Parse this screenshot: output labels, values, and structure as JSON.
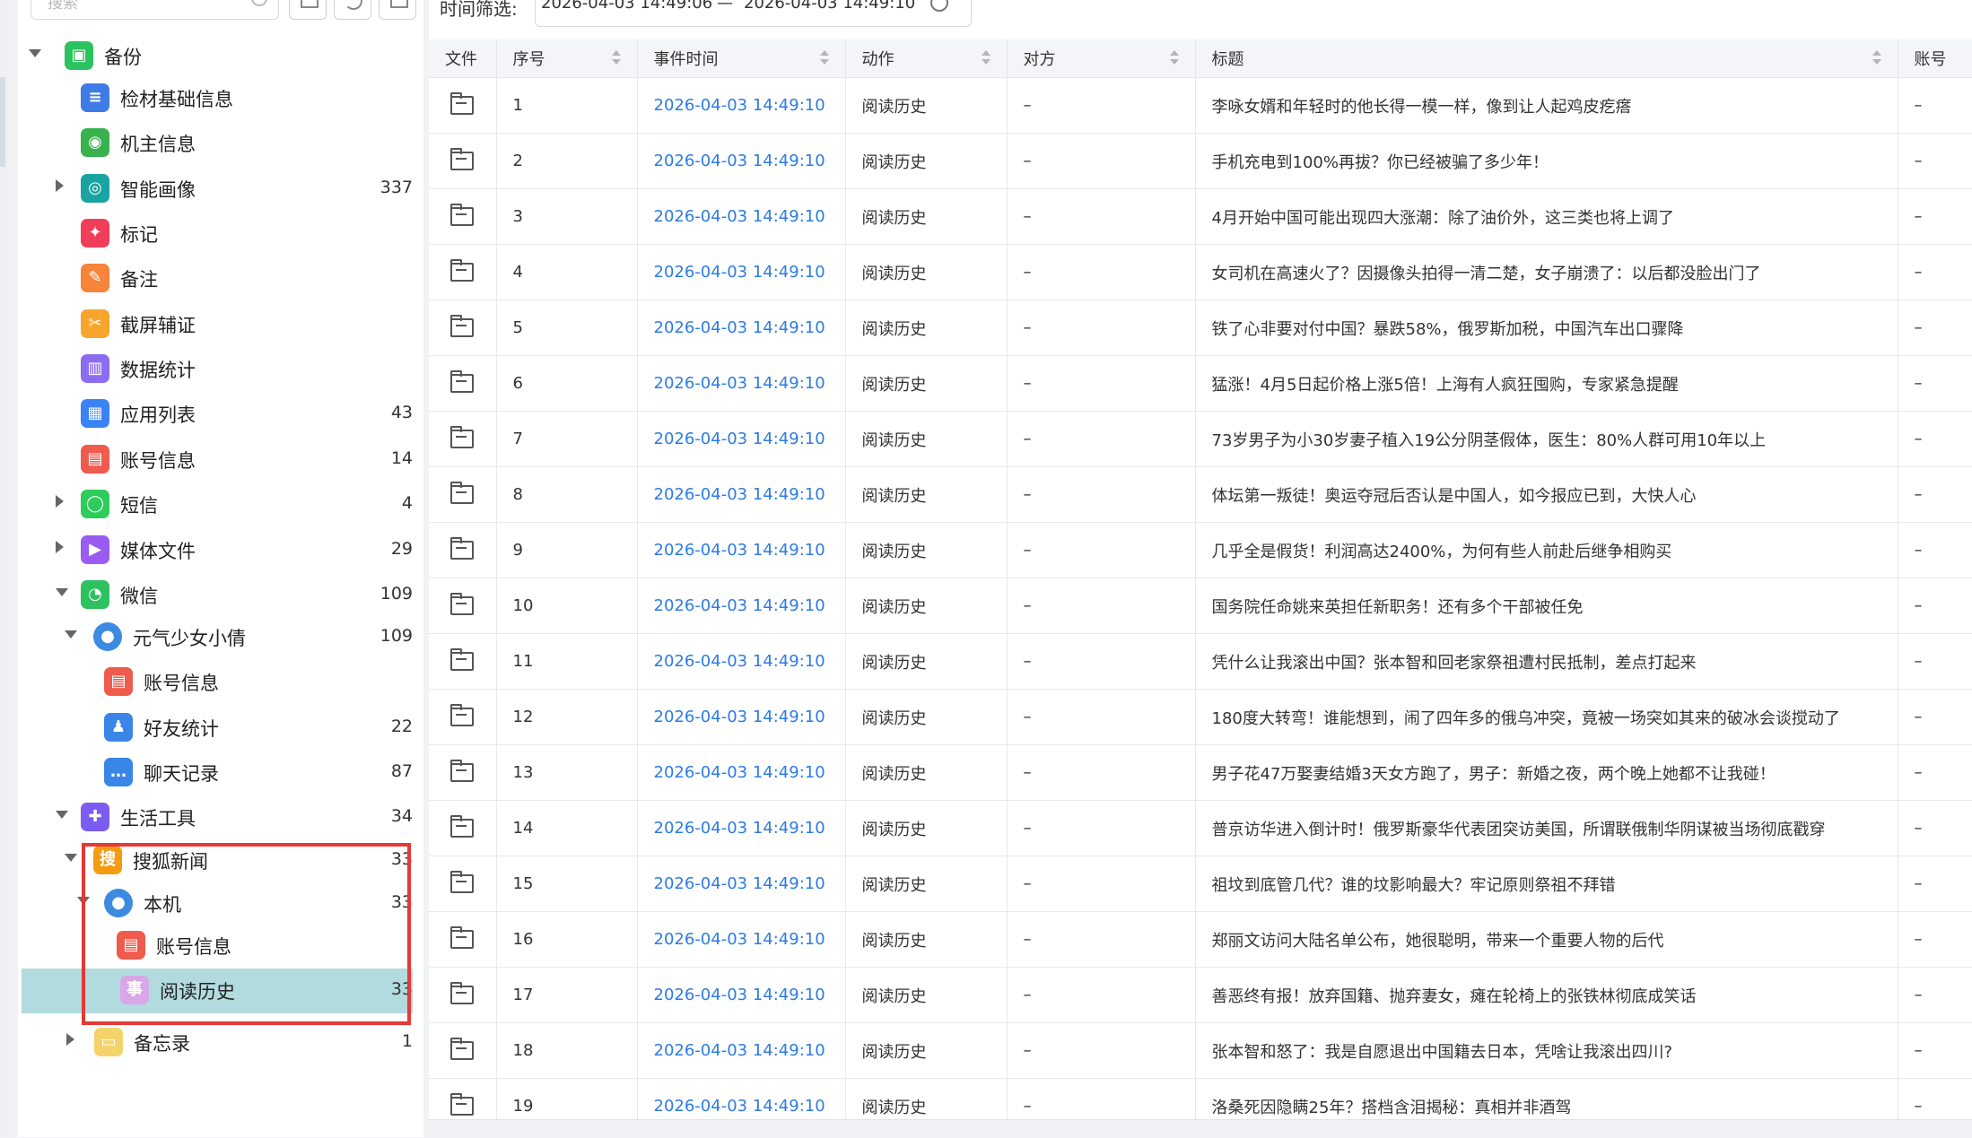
{
  "sidebar": {
    "search_placeholder": "搜索",
    "tree": [
      {
        "label": "备份",
        "count": "",
        "depth": 0,
        "arrow": "down",
        "icon": "backup-icon",
        "color": "#2bc35e",
        "glyph": "▣"
      },
      {
        "label": "检材基础信息",
        "count": "",
        "depth": 1,
        "arrow": "",
        "icon": "document-icon",
        "color": "#3f7be6",
        "glyph": "≡"
      },
      {
        "label": "机主信息",
        "count": "",
        "depth": 1,
        "arrow": "",
        "icon": "owner-icon",
        "color": "#37b24d",
        "glyph": "◉"
      },
      {
        "label": "智能画像",
        "count": "337",
        "depth": 1,
        "arrow": "right",
        "icon": "portrait-icon",
        "color": "#1aa3a3",
        "glyph": "◎"
      },
      {
        "label": "标记",
        "count": "",
        "depth": 1,
        "arrow": "",
        "icon": "pin-icon",
        "color": "#f03e5a",
        "glyph": "✦"
      },
      {
        "label": "备注",
        "count": "",
        "depth": 1,
        "arrow": "",
        "icon": "note-icon",
        "color": "#f6843b",
        "glyph": "✎"
      },
      {
        "label": "截屏辅证",
        "count": "",
        "depth": 1,
        "arrow": "",
        "icon": "scissors-icon",
        "color": "#f7a52c",
        "glyph": "✂"
      },
      {
        "label": "数据统计",
        "count": "",
        "depth": 1,
        "arrow": "",
        "icon": "bar-chart-icon",
        "color": "#8c6cf0",
        "glyph": "▥"
      },
      {
        "label": "应用列表",
        "count": "43",
        "depth": 1,
        "arrow": "",
        "icon": "apps-grid-icon",
        "color": "#3b82f6",
        "glyph": "▦"
      },
      {
        "label": "账号信息",
        "count": "14",
        "depth": 1,
        "arrow": "",
        "icon": "id-card-icon",
        "color": "#ef5b4c",
        "glyph": "▤"
      },
      {
        "label": "短信",
        "count": "4",
        "depth": 1,
        "arrow": "right",
        "icon": "sms-icon",
        "color": "#2ecc5a",
        "glyph": "◯"
      },
      {
        "label": "媒体文件",
        "count": "29",
        "depth": 1,
        "arrow": "right",
        "icon": "media-icon",
        "color": "#9a5cf0",
        "glyph": "▶"
      },
      {
        "label": "微信",
        "count": "109",
        "depth": 1,
        "arrow": "down",
        "icon": "wechat-icon",
        "color": "#2ec15f",
        "glyph": "◔"
      },
      {
        "label": "元气少女小倩",
        "count": "109",
        "depth": 2,
        "arrow": "down",
        "icon": "user-avatar-icon",
        "color": "#3d8be0",
        "glyph": "●"
      },
      {
        "label": "账号信息",
        "count": "",
        "depth": 3,
        "arrow": "",
        "icon": "id-card-icon",
        "color": "#ef5b4c",
        "glyph": "▤"
      },
      {
        "label": "好友统计",
        "count": "22",
        "depth": 3,
        "arrow": "",
        "icon": "friends-icon",
        "color": "#3a86e8",
        "glyph": "♟"
      },
      {
        "label": "聊天记录",
        "count": "87",
        "depth": 3,
        "arrow": "",
        "icon": "chat-icon",
        "color": "#3a86e8",
        "glyph": "…"
      },
      {
        "label": "生活工具",
        "count": "34",
        "depth": 1,
        "arrow": "down",
        "icon": "tools-icon",
        "color": "#7b5cf0",
        "glyph": "✚"
      },
      {
        "label": "搜狐新闻",
        "count": "33",
        "depth": 2,
        "arrow": "down",
        "icon": "sohu-news-icon",
        "color": "#f39c12",
        "glyph": "搜"
      },
      {
        "label": "本机",
        "count": "33",
        "depth": 2.5,
        "arrow": "down",
        "icon": "user-avatar-icon",
        "color": "#3d8be0",
        "glyph": "●"
      },
      {
        "label": "账号信息",
        "count": "",
        "depth": 3.5,
        "arrow": "",
        "icon": "id-card-icon",
        "color": "#ef5b4c",
        "glyph": "▤"
      },
      {
        "label": "阅读历史",
        "count": "33",
        "depth": 3.5,
        "arrow": "",
        "icon": "reading-history-icon",
        "color": "#d9a6e8",
        "glyph": "事",
        "selected": true
      },
      {
        "label": "备忘录",
        "count": "1",
        "depth": 1.5,
        "arrow": "right",
        "icon": "memo-icon",
        "color": "#f5d36b",
        "glyph": "▭"
      }
    ]
  },
  "filter": {
    "label": "时间筛选:",
    "start": "2026-04-03 14:49:06",
    "sep": "—",
    "end": "2026-04-03 14:49:10"
  },
  "table": {
    "columns": [
      "文件",
      "序号",
      "事件时间",
      "动作",
      "对方",
      "标题",
      "账号"
    ],
    "rows": [
      {
        "seq": "1",
        "time": "2026-04-03 14:49:10",
        "action": "阅读历史",
        "party": "–",
        "title": "李咏女婿和年轻时的他长得一模一样，像到让人起鸡皮疙瘩",
        "account": "–"
      },
      {
        "seq": "2",
        "time": "2026-04-03 14:49:10",
        "action": "阅读历史",
        "party": "–",
        "title": "手机充电到100%再拔？你已经被骗了多少年！",
        "account": "–"
      },
      {
        "seq": "3",
        "time": "2026-04-03 14:49:10",
        "action": "阅读历史",
        "party": "–",
        "title": "4月开始中国可能出现四大涨潮：除了油价外，这三类也将上调了",
        "account": "–"
      },
      {
        "seq": "4",
        "time": "2026-04-03 14:49:10",
        "action": "阅读历史",
        "party": "–",
        "title": "女司机在高速火了？因摄像头拍得一清二楚，女子崩溃了：以后都没脸出门了",
        "account": "–"
      },
      {
        "seq": "5",
        "time": "2026-04-03 14:49:10",
        "action": "阅读历史",
        "party": "–",
        "title": "铁了心非要对付中国？暴跌58%，俄罗斯加税，中国汽车出口骤降",
        "account": "–"
      },
      {
        "seq": "6",
        "time": "2026-04-03 14:49:10",
        "action": "阅读历史",
        "party": "–",
        "title": "猛涨！4月5日起价格上涨5倍！上海有人疯狂囤购，专家紧急提醒",
        "account": "–"
      },
      {
        "seq": "7",
        "time": "2026-04-03 14:49:10",
        "action": "阅读历史",
        "party": "–",
        "title": "73岁男子为小30岁妻子植入19公分阴茎假体，医生：80%人群可用10年以上",
        "account": "–"
      },
      {
        "seq": "8",
        "time": "2026-04-03 14:49:10",
        "action": "阅读历史",
        "party": "–",
        "title": "体坛第一叛徒！奥运夺冠后否认是中国人，如今报应已到，大快人心",
        "account": "–"
      },
      {
        "seq": "9",
        "time": "2026-04-03 14:49:10",
        "action": "阅读历史",
        "party": "–",
        "title": "几乎全是假货！利润高达2400%，为何有些人前赴后继争相购买",
        "account": "–"
      },
      {
        "seq": "10",
        "time": "2026-04-03 14:49:10",
        "action": "阅读历史",
        "party": "–",
        "title": "国务院任命姚来英担任新职务！还有多个干部被任免",
        "account": "–"
      },
      {
        "seq": "11",
        "time": "2026-04-03 14:49:10",
        "action": "阅读历史",
        "party": "–",
        "title": "凭什么让我滚出中国？张本智和回老家祭祖遭村民抵制，差点打起来",
        "account": "–"
      },
      {
        "seq": "12",
        "time": "2026-04-03 14:49:10",
        "action": "阅读历史",
        "party": "–",
        "title": "180度大转弯！谁能想到，闹了四年多的俄乌冲突，竟被一场突如其来的破冰会谈搅动了",
        "account": "–"
      },
      {
        "seq": "13",
        "time": "2026-04-03 14:49:10",
        "action": "阅读历史",
        "party": "–",
        "title": "男子花47万娶妻结婚3天女方跑了，男子：新婚之夜，两个晚上她都不让我碰！",
        "account": "–"
      },
      {
        "seq": "14",
        "time": "2026-04-03 14:49:10",
        "action": "阅读历史",
        "party": "–",
        "title": "普京访华进入倒计时！俄罗斯豪华代表团突访美国，所谓联俄制华阴谋被当场彻底戳穿",
        "account": "–"
      },
      {
        "seq": "15",
        "time": "2026-04-03 14:49:10",
        "action": "阅读历史",
        "party": "–",
        "title": "祖坟到底管几代？谁的坟影响最大？牢记原则祭祖不拜错",
        "account": "–"
      },
      {
        "seq": "16",
        "time": "2026-04-03 14:49:10",
        "action": "阅读历史",
        "party": "–",
        "title": "郑丽文访问大陆名单公布，她很聪明，带来一个重要人物的后代",
        "account": "–"
      },
      {
        "seq": "17",
        "time": "2026-04-03 14:49:10",
        "action": "阅读历史",
        "party": "–",
        "title": "善恶终有报！放弃国籍、抛弃妻女，瘫在轮椅上的张铁林彻底成笑话",
        "account": "–"
      },
      {
        "seq": "18",
        "time": "2026-04-03 14:49:10",
        "action": "阅读历史",
        "party": "–",
        "title": "张本智和怒了：我是自愿退出中国籍去日本，凭啥让我滚出四川?",
        "account": "–"
      },
      {
        "seq": "19",
        "time": "2026-04-03 14:49:10",
        "action": "阅读历史",
        "party": "–",
        "title": "洛桑死因隐瞒25年？搭档含泪揭秘：真相并非酒驾",
        "account": "–"
      }
    ]
  }
}
